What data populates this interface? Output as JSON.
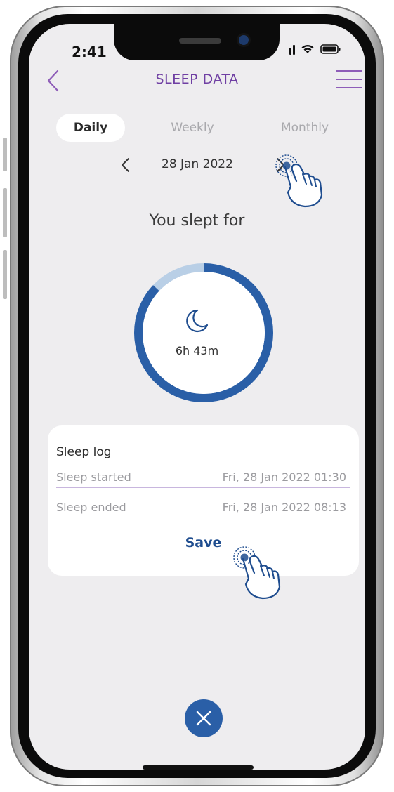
{
  "status_bar": {
    "time": "2:41"
  },
  "header": {
    "title": "SLEEP DATA"
  },
  "tabs": [
    {
      "label": "Daily",
      "active": true
    },
    {
      "label": "Weekly",
      "active": false
    },
    {
      "label": "Monthly",
      "active": false
    }
  ],
  "date_nav": {
    "date": "28 Jan 2022"
  },
  "summary": {
    "heading": "You slept for",
    "duration": "6h 43m",
    "ring_fraction": 0.87
  },
  "sleep_log": {
    "title": "Sleep log",
    "rows": [
      {
        "label": "Sleep started",
        "value": "Fri, 28 Jan 2022 01:30"
      },
      {
        "label": "Sleep ended",
        "value": "Fri, 28 Jan 2022 08:13"
      }
    ],
    "save_label": "Save"
  },
  "colors": {
    "accent_purple": "#6f3fa3",
    "primary_blue": "#2a5fa7",
    "ring_track": "#b9cfe6",
    "background": "#eeedef"
  },
  "icons": [
    "back-chevron-icon",
    "menu-icon",
    "moon-icon",
    "close-icon",
    "signal-icon",
    "wifi-icon",
    "battery-icon",
    "tap-hand-icon"
  ]
}
